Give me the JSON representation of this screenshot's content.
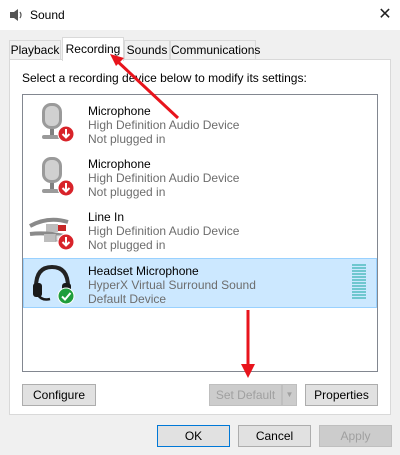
{
  "window": {
    "title": "Sound",
    "close_glyph": "✕",
    "title_icon": "speaker-icon"
  },
  "tabs": [
    {
      "label": "Playback",
      "active": false
    },
    {
      "label": "Recording",
      "active": true
    },
    {
      "label": "Sounds",
      "active": false
    },
    {
      "label": "Communications",
      "active": false
    }
  ],
  "instruction": "Select a recording device below to modify its settings:",
  "devices": [
    {
      "name": "Microphone",
      "driver": "High Definition Audio Device",
      "status": "Not plugged in",
      "icon": "microphone-icon",
      "badge": "unplugged-badge",
      "selected": false
    },
    {
      "name": "Microphone",
      "driver": "High Definition Audio Device",
      "status": "Not plugged in",
      "icon": "microphone-icon",
      "badge": "unplugged-badge",
      "selected": false
    },
    {
      "name": "Line In",
      "driver": "High Definition Audio Device",
      "status": "Not plugged in",
      "icon": "line-in-cable-icon",
      "badge": "unplugged-badge",
      "selected": false
    },
    {
      "name": "Headset Microphone",
      "driver": "HyperX Virtual Surround Sound",
      "status": "Default Device",
      "icon": "headset-icon",
      "badge": "default-check-badge",
      "selected": true
    }
  ],
  "buttons": {
    "configure": "Configure",
    "set_default": "Set Default",
    "set_default_dropdown": "▼",
    "properties": "Properties",
    "ok": "OK",
    "cancel": "Cancel",
    "apply": "Apply"
  },
  "colors": {
    "selection_bg": "#cce8ff",
    "selection_border": "#99d1ff",
    "annotation_arrow": "#e8141c",
    "default_badge": "#1f9e3c",
    "unplugged_badge": "#d8232a"
  }
}
